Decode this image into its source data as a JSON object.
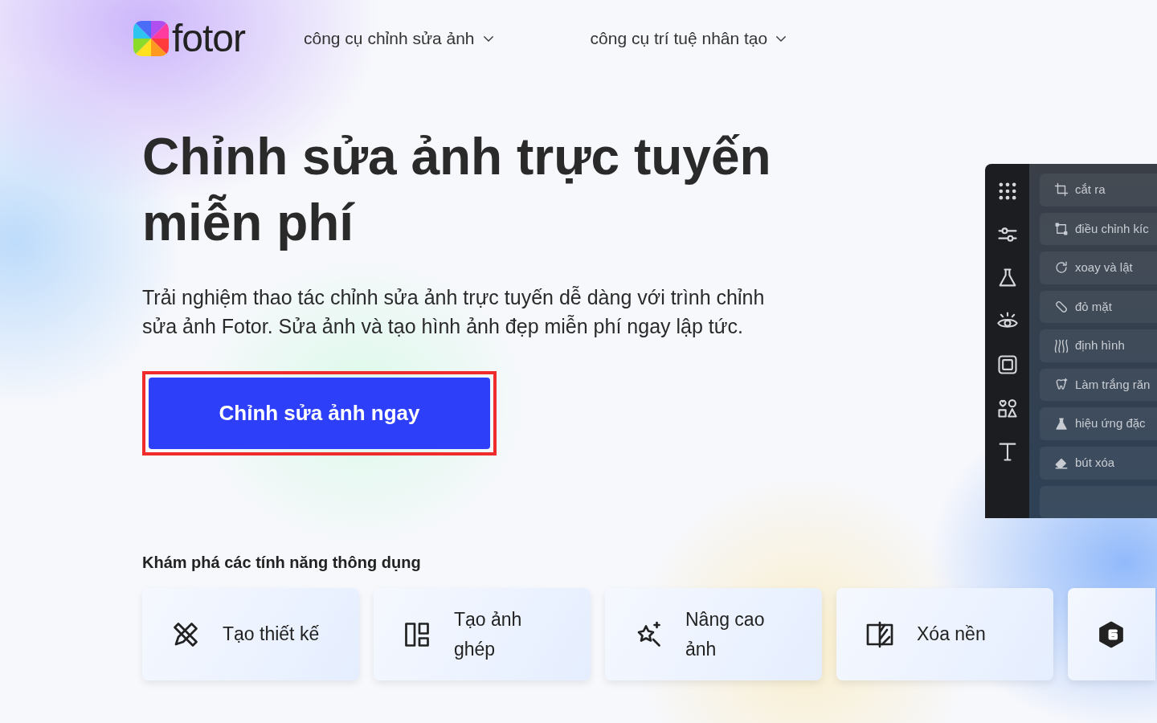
{
  "header": {
    "logo_text": "fotor",
    "nav": [
      {
        "label": "công cụ chỉnh sửa ảnh"
      },
      {
        "label": "công cụ trí tuệ nhân tạo"
      }
    ]
  },
  "hero": {
    "title": "Chỉnh sửa ảnh trực tuyến miễn phí",
    "description": "Trải nghiệm thao tác chỉnh sửa ảnh trực tuyến dễ dàng với trình chỉnh sửa ảnh Fotor. Sửa ảnh và tạo hình ảnh đẹp miễn phí ngay lập tức.",
    "cta": {
      "label": "Chỉnh sửa ảnh ngay",
      "highlighted": true
    }
  },
  "editor_preview": {
    "tools": [
      {
        "kind": "grid"
      },
      {
        "kind": "sliders"
      },
      {
        "kind": "flask"
      },
      {
        "kind": "eye"
      },
      {
        "kind": "frame"
      },
      {
        "kind": "shapes"
      },
      {
        "kind": "text"
      }
    ],
    "items": [
      {
        "label": "cắt ra",
        "kind": "crop"
      },
      {
        "label": "điều chỉnh kíc",
        "kind": "resize"
      },
      {
        "label": "xoay và lật",
        "kind": "rotate"
      },
      {
        "label": "đỏ mặt",
        "kind": "bandage"
      },
      {
        "label": "định hình",
        "kind": "shape"
      },
      {
        "label": "Làm trắng răn",
        "kind": "tooth"
      },
      {
        "label": "hiệu ứng đặc",
        "kind": "flask"
      },
      {
        "label": "bút xóa",
        "kind": "eraser"
      },
      {
        "kind": "blank"
      }
    ]
  },
  "features": {
    "heading": "Khám phá các tính năng thông dụng",
    "cards": [
      {
        "label": "Tạo thiết kế",
        "kind": "design"
      },
      {
        "label": "Tạo ảnh ghép",
        "kind": "collage"
      },
      {
        "label": "Nâng cao ảnh",
        "kind": "enhance"
      },
      {
        "label": "Xóa nền",
        "kind": "remove-bg"
      },
      {
        "kind": "grammar"
      }
    ]
  }
}
